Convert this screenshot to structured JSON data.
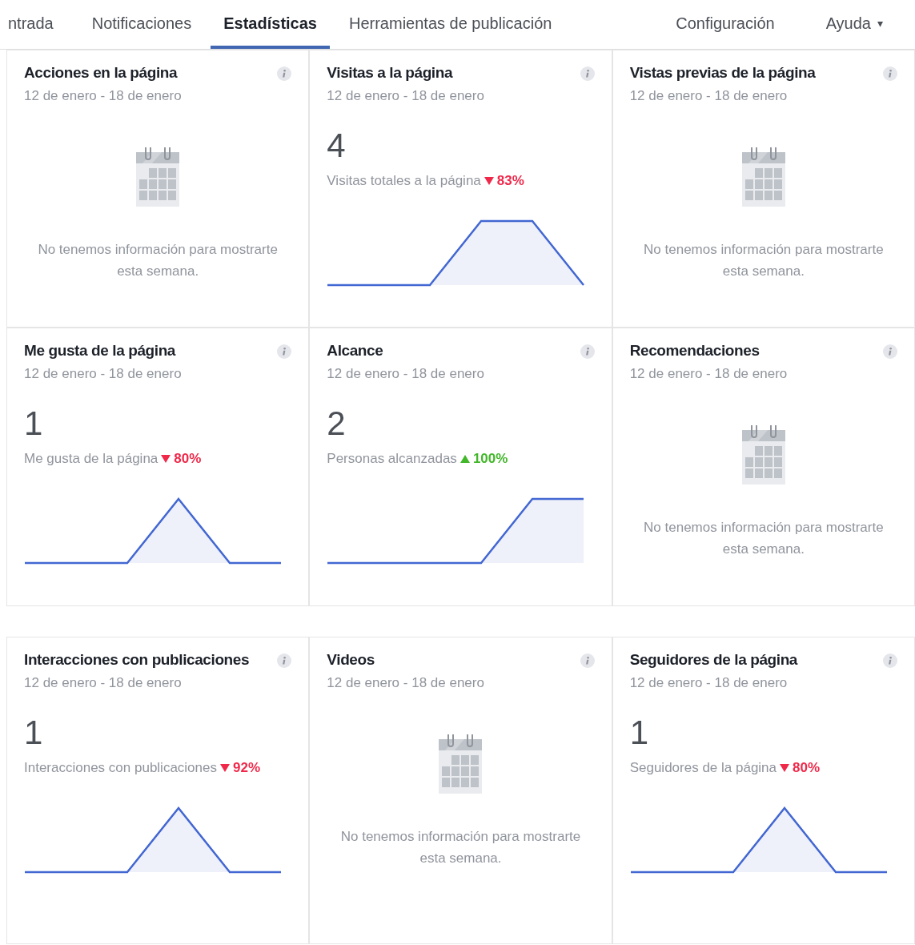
{
  "tabs": [
    {
      "label": "ntrada",
      "selected": false
    },
    {
      "label": "Notificaciones",
      "selected": false
    },
    {
      "label": "Estadísticas",
      "selected": true
    },
    {
      "label": "Herramientas de publicación",
      "selected": false
    }
  ],
  "right_tabs": [
    {
      "label": "Configuración",
      "selected": false,
      "dropdown": false
    },
    {
      "label": "Ayuda",
      "selected": false,
      "dropdown": true
    }
  ],
  "dropdown_caret": "▾",
  "cards": [
    {
      "kind": "empty",
      "title": "Acciones en la página",
      "date_range": "12 de enero - 18 de enero",
      "message": "No tenemos información para mostrarte esta semana."
    },
    {
      "kind": "metric",
      "title": "Visitas a la página",
      "date_range": "12 de enero - 18 de enero",
      "value": "4",
      "label": "Visitas totales a la página",
      "increase": false,
      "change": "83%"
    },
    {
      "kind": "empty",
      "title": "Vistas previas de la página",
      "date_range": "12 de enero - 18 de enero",
      "message": "No tenemos información para mostrarte esta semana."
    },
    {
      "kind": "metric",
      "title": "Me gusta de la página",
      "date_range": "12 de enero - 18 de enero",
      "value": "1",
      "label": "Me gusta de la página",
      "increase": false,
      "change": "80%"
    },
    {
      "kind": "metric",
      "title": "Alcance",
      "date_range": "12 de enero - 18 de enero",
      "value": "2",
      "label": "Personas alcanzadas",
      "increase": true,
      "change": "100%"
    },
    {
      "kind": "empty",
      "title": "Recomendaciones",
      "date_range": "12 de enero - 18 de enero",
      "message": "No tenemos información para mostrarte esta semana."
    },
    {
      "kind": "metric",
      "title": "Interacciones con publicaciones",
      "date_range": "12 de enero - 18 de enero",
      "value": "1",
      "label": "Interacciones con publicaciones",
      "increase": false,
      "change": "92%"
    },
    {
      "kind": "empty",
      "title": "Videos",
      "date_range": "12 de enero - 18 de enero",
      "message": "No tenemos información para mostrarte esta semana."
    },
    {
      "kind": "metric",
      "title": "Seguidores de la página",
      "date_range": "12 de enero - 18 de enero",
      "value": "1",
      "label": "Seguidores de la página",
      "increase": false,
      "change": "80%"
    }
  ]
}
